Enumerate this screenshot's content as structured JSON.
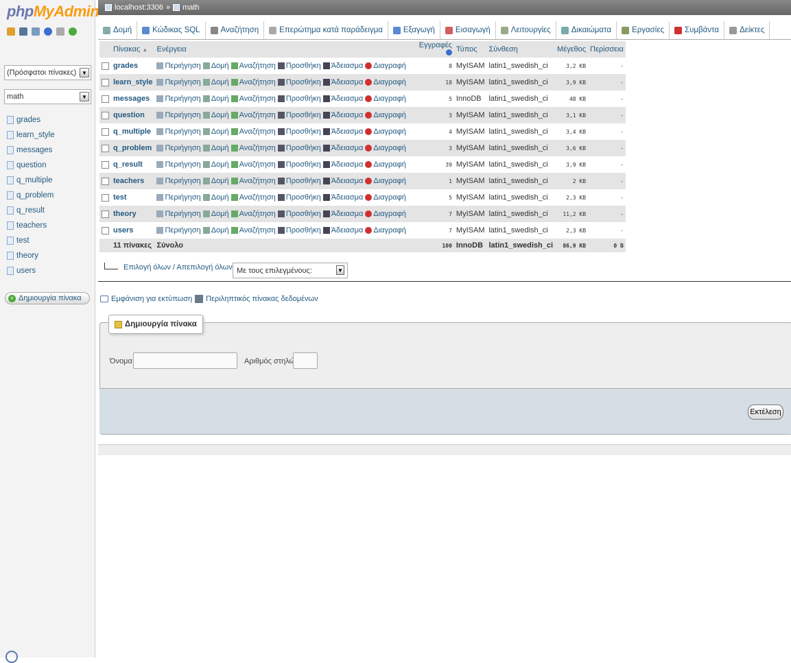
{
  "logo": {
    "part1": "php",
    "part2": "MyAdmin"
  },
  "sidebar": {
    "recent": "(Πρόσφατοι πίνακες) ...",
    "db": "math",
    "tables": [
      "grades",
      "learn_style",
      "messages",
      "question",
      "q_multiple",
      "q_problem",
      "q_result",
      "teachers",
      "test",
      "theory",
      "users"
    ],
    "create_label": "Δημιουργία πίνακα"
  },
  "breadcrumb": {
    "server": "localhost:3306",
    "sep": "»",
    "db": "math"
  },
  "tabs": [
    "Δομή",
    "Κώδικας SQL",
    "Αναζήτηση",
    "Επερώτημα κατά παράδειγμα",
    "Εξαγωγή",
    "Εισαγωγή",
    "Λειτουργίες",
    "Δικαιώματα",
    "Εργασίες",
    "Συμβάντα",
    "Δείκτες"
  ],
  "table_headers": {
    "table": "Πίνακας",
    "action": "Ενέργεια",
    "rows": "Εγγραφές",
    "type": "Τύπος",
    "collation": "Σύνθεση",
    "size": "Μέγεθος",
    "overhead": "Περίσσεια"
  },
  "actions": [
    "Περιήγηση",
    "Δομή",
    "Αναζήτηση",
    "Προσθήκη",
    "Άδειασμα",
    "Διαγραφή"
  ],
  "rows": [
    {
      "name": "grades",
      "rows": "8",
      "type": "MyISAM",
      "collation": "latin1_swedish_ci",
      "size": "3,2",
      "unit": "KB",
      "overhead": "-"
    },
    {
      "name": "learn_style",
      "rows": "18",
      "type": "MyISAM",
      "collation": "latin1_swedish_ci",
      "size": "3,9",
      "unit": "KB",
      "overhead": "-"
    },
    {
      "name": "messages",
      "rows": "5",
      "type": "InnoDB",
      "collation": "latin1_swedish_ci",
      "size": "48",
      "unit": "KB",
      "overhead": "-"
    },
    {
      "name": "question",
      "rows": "3",
      "type": "MyISAM",
      "collation": "latin1_swedish_ci",
      "size": "3,1",
      "unit": "KB",
      "overhead": "-"
    },
    {
      "name": "q_multiple",
      "rows": "4",
      "type": "MyISAM",
      "collation": "latin1_swedish_ci",
      "size": "3,4",
      "unit": "KB",
      "overhead": "-"
    },
    {
      "name": "q_problem",
      "rows": "3",
      "type": "MyISAM",
      "collation": "latin1_swedish_ci",
      "size": "3,6",
      "unit": "KB",
      "overhead": "-"
    },
    {
      "name": "q_result",
      "rows": "39",
      "type": "MyISAM",
      "collation": "latin1_swedish_ci",
      "size": "3,9",
      "unit": "KB",
      "overhead": "-"
    },
    {
      "name": "teachers",
      "rows": "1",
      "type": "MyISAM",
      "collation": "latin1_swedish_ci",
      "size": "2",
      "unit": "KB",
      "overhead": "-"
    },
    {
      "name": "test",
      "rows": "5",
      "type": "MyISAM",
      "collation": "latin1_swedish_ci",
      "size": "2,3",
      "unit": "KB",
      "overhead": "-"
    },
    {
      "name": "theory",
      "rows": "7",
      "type": "MyISAM",
      "collation": "latin1_swedish_ci",
      "size": "11,2",
      "unit": "KB",
      "overhead": "-"
    },
    {
      "name": "users",
      "rows": "7",
      "type": "MyISAM",
      "collation": "latin1_swedish_ci",
      "size": "2,3",
      "unit": "KB",
      "overhead": "-"
    }
  ],
  "total": {
    "count": "11 πίνακες",
    "label": "Σύνολο",
    "rows": "100",
    "type": "InnoDB",
    "collation": "latin1_swedish_ci",
    "size": "86,9",
    "unit": "KB",
    "overhead": "0",
    "overhead_unit": "B"
  },
  "bulk": {
    "check_all": "Επιλογή όλων / Απεπιλογή όλων",
    "with_selected": "Με τους επιλεγμένους:"
  },
  "links": {
    "print": "Εμφάνιση για εκτύπωση",
    "dictionary": "Περιληπτικός πίνακας δεδομένων"
  },
  "create_form": {
    "legend": "Δημιουργία πίνακα",
    "name_label": "Όνομα:",
    "cols_label": "Αριθμός στηλών:",
    "name_value": "",
    "cols_value": "",
    "submit": "Εκτέλεση"
  },
  "colors": {
    "link": "#235a81",
    "logo_php": "#6c78af",
    "logo_admin": "#f89c0e",
    "row_even": "#e4e4e4"
  }
}
